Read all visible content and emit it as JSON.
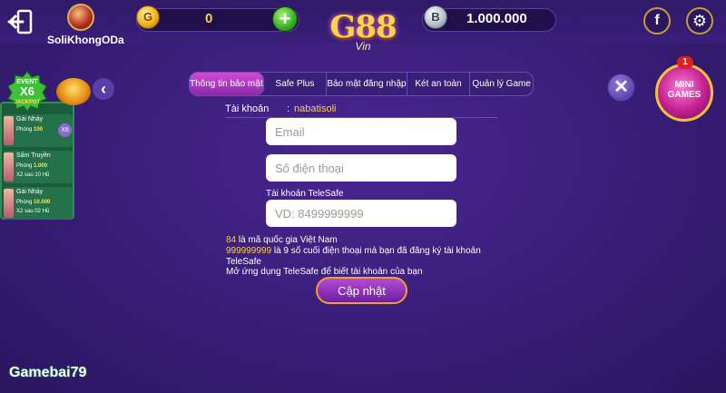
{
  "header": {
    "username": "SoliKhongODa",
    "gold_balance": "0",
    "gold_coin_letter": "G",
    "silver_balance": "1.000.000",
    "silver_coin_letter": "B",
    "logo_text": "G88",
    "logo_sub": "Vin",
    "facebook_label": "f",
    "settings_label": "⚙"
  },
  "tabs": [
    {
      "label": "Thông tin bảo mật"
    },
    {
      "label": "Safe Plus"
    },
    {
      "label": "Bảo mật đăng nhập"
    },
    {
      "label": "Két an toàn"
    },
    {
      "label": "Quản lý Game"
    }
  ],
  "jackpot": {
    "event_line1": "EVENT",
    "event_line2": "X6",
    "event_line3": "JACKPOT",
    "rows": [
      {
        "name": "Gái Nhảy",
        "room_label": "Phòng",
        "room_value": "100",
        "extra": "",
        "chip": "X6"
      },
      {
        "name": "Sấm Truyền",
        "room_label": "Phòng",
        "room_value": "1.000",
        "extra": "X2 sau 10 Hũ",
        "chip": ""
      },
      {
        "name": "Gái Nhảy",
        "room_label": "Phòng",
        "room_value": "10.000",
        "extra": "X2 sau 02 Hũ",
        "chip": ""
      }
    ]
  },
  "side": {
    "close_label": "✕",
    "mini_line1": "MINI",
    "mini_line2": "GAMES",
    "mini_badge": "1",
    "back_label": "‹"
  },
  "form": {
    "account_label": "Tài khoản",
    "account_colon": ":",
    "account_value": "nabatisoli",
    "email_placeholder": "Email",
    "phone_placeholder": "Số điện thoại",
    "telesafe_label": "Tài khoản TeleSafe",
    "telesafe_placeholder": "VD: 8499999999",
    "info1_hl": "84",
    "info1_rest": " là mã quốc gia Việt Nam",
    "info2_hl": "999999999",
    "info2_rest": " là 9 số cuối điện thoại mà bạn đã đăng ký tài khoản",
    "info3": "TeleSafe",
    "info4": "Mở ứng dụng TeleSafe để biết tài khoản của bạn",
    "submit_label": "Cập nhật"
  },
  "watermark": "Gamebai79",
  "colors": {
    "accent": "#f7d14a",
    "background": "#3b1f7c",
    "button_border": "#f0a12a"
  }
}
